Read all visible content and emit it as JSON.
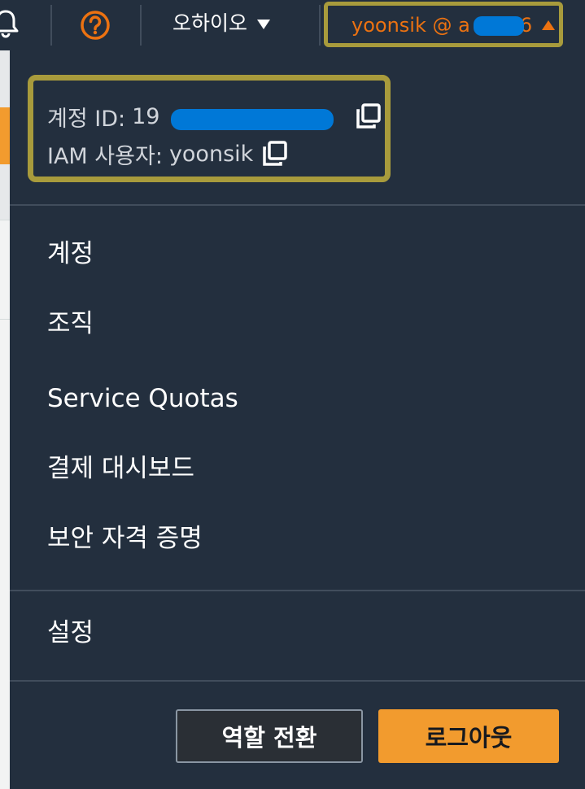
{
  "navbar": {
    "region": "오하이오",
    "account": "yoonsik @ a        6"
  },
  "account_info": {
    "account_id_label": "계정 ID:",
    "account_id_value": "19",
    "iam_user_label": "IAM 사용자:",
    "iam_user_value": "yoonsik"
  },
  "menu": {
    "items": [
      "계정",
      "조직",
      "Service Quotas",
      "결제 대시보드",
      "보안 자격 증명"
    ],
    "settings": "설정"
  },
  "buttons": {
    "switch_role": "역할 전환",
    "sign_out": "로그아웃"
  },
  "colors": {
    "background": "#232f3e",
    "accent_orange": "#f29b2e",
    "account_text": "#ec7211",
    "highlight_annotation": "#a89b3c",
    "redaction": "#0078d7"
  },
  "icons": [
    "bell-icon",
    "help-icon",
    "caret-down-icon",
    "caret-up-icon",
    "copy-icon"
  ]
}
